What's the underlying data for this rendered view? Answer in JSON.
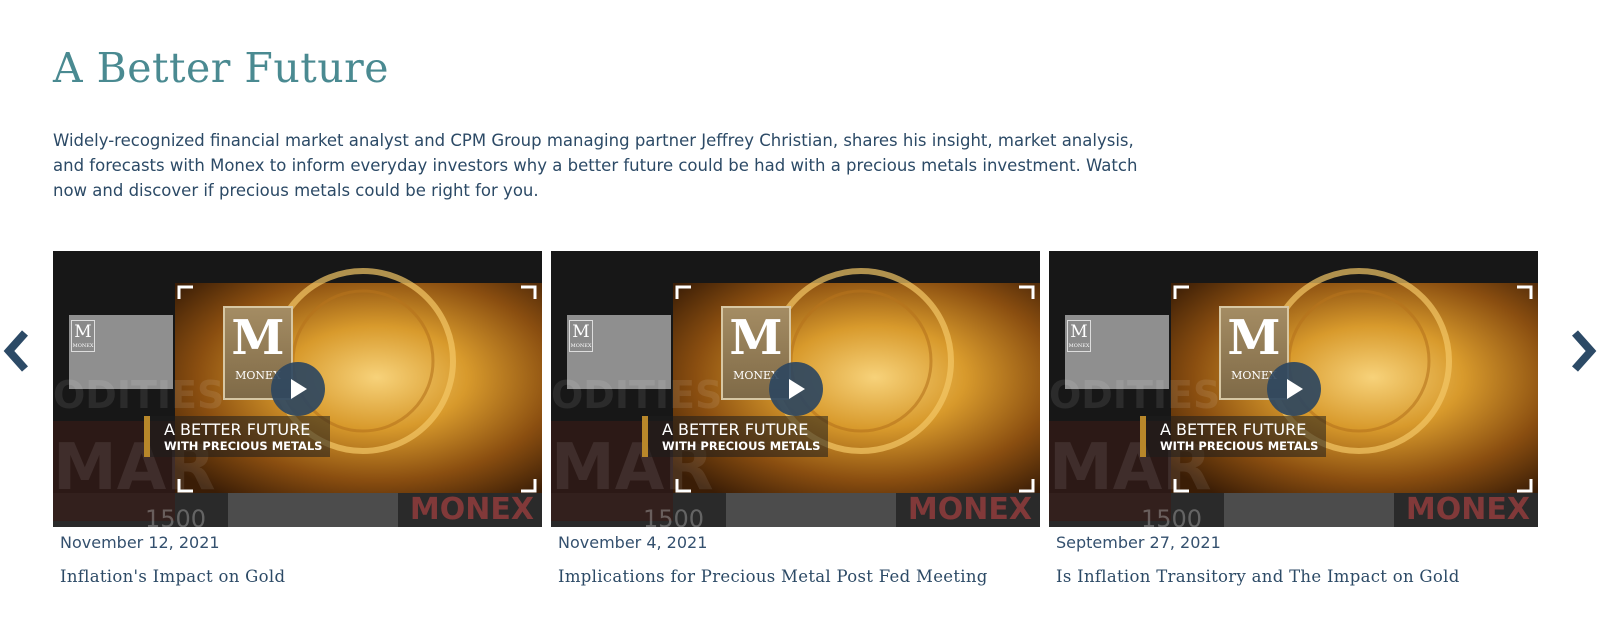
{
  "section": {
    "title": "A Better Future",
    "description": "Widely-recognized financial market analyst and CPM Group managing partner Jeffrey Christian, shares his insight, market analysis, and forecasts with Monex to inform everyday investors why a better future could be had with a precious metals investment. Watch now and discover if precious metals could be right for you."
  },
  "carousel": {
    "prev_icon": "chevron-left-icon",
    "next_icon": "chevron-right-icon",
    "arrow_color": "#2c4a66",
    "thumbnail": {
      "logo_letter": "M",
      "logo_word": "MONEX",
      "overlay_line1": "A BETTER FUTURE",
      "overlay_line2": "WITH PRECIOUS METALS",
      "brand_text": "MONEX",
      "number_text": "1500",
      "ghost_text_1": "ODITIES",
      "ghost_text_2": "MAR"
    },
    "videos": [
      {
        "date": "November 12, 2021",
        "title": "Inflation's Impact on Gold"
      },
      {
        "date": "November 4, 2021",
        "title": "Implications for Precious Metal Post Fed Meeting"
      },
      {
        "date": "September 27, 2021",
        "title": "Is Inflation Transitory and The Impact on Gold"
      }
    ]
  },
  "colors": {
    "title": "#4a8a91",
    "text": "#2c4a66",
    "play_button": "#2e4660",
    "accent_gold": "#b8872a"
  }
}
